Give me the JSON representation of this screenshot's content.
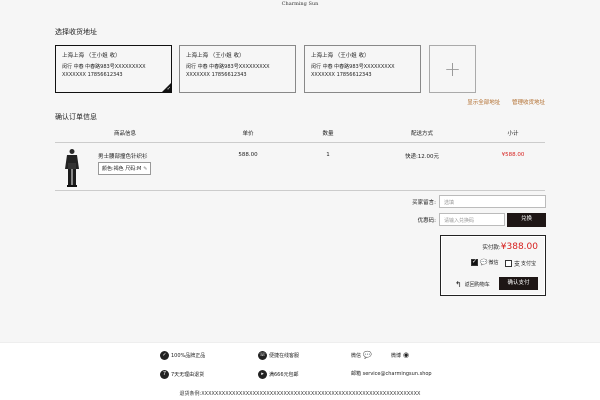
{
  "brand": "Charming Sun",
  "address_section": {
    "title": "选择收货地址",
    "cards": [
      {
        "name": "上海上海 （王小姐 收）",
        "line1": "闵行 中春 中春路983号XXXXXXXXX",
        "line2": "XXXXXXX  17856612343",
        "selected": true
      },
      {
        "name": "上海上海 （王小姐 收）",
        "line1": "闵行 中春 中春路983号XXXXXXXXX",
        "line2": "XXXXXXX  17856612343",
        "selected": false
      },
      {
        "name": "上海上海 （王小姐 收）",
        "line1": "闵行 中春 中春路983号XXXXXXXXX",
        "line2": "XXXXXXX  17856612343",
        "selected": false
      }
    ],
    "add_symbol": "+",
    "show_all_label": "显示全部地址",
    "manage_label": "管理收货地址"
  },
  "order_section": {
    "title": "确认订单信息",
    "headers": [
      "商品信息",
      "单价",
      "数量",
      "配送方式",
      "小计"
    ],
    "item": {
      "name": "男士腰部撞色针织衫",
      "spec": "颜色:褐色  尺码:M",
      "price": "588.00",
      "qty": "1",
      "shipping": "快递:12.00元",
      "subtotal": "¥588.00"
    }
  },
  "message": {
    "label": "买家留言:",
    "placeholder": "选填"
  },
  "coupon": {
    "label": "优惠码:",
    "placeholder": "请输入兑换码",
    "button": "兑换"
  },
  "payment": {
    "amount_label": "实付款:",
    "amount": "¥388.00",
    "wechat_label": "微信",
    "alipay_label": "支付宝",
    "back_label": "返回购物车",
    "submit_label": "确认支付"
  },
  "footer": {
    "genuine": "100%品牌正品",
    "service": "便捷在线客服",
    "wechat": "微信",
    "weibo": "微博",
    "returns": "7天无理由退货",
    "free_ship": "满666元包邮",
    "email": "邮箱 service@charmingsun.shop",
    "terms": "退货条例:XXXXXXXXXXXXXXXXXXXXXXXXXXXXXXXXXXXXXXXXXXXXXXXXXXXXXXXXXXXXXXXX"
  },
  "colors": {
    "accent_red": "#d6201e",
    "dark_button": "#1e1615",
    "link": "#b06b2a"
  }
}
